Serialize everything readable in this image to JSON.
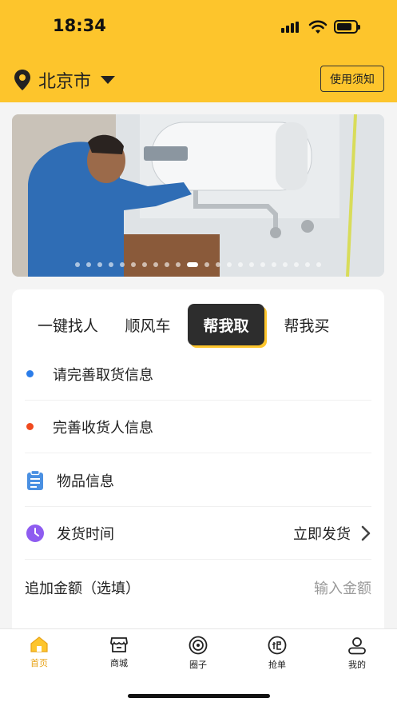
{
  "status": {
    "time": "18:34"
  },
  "header": {
    "city": "北京市",
    "notice_label": "使用须知"
  },
  "banner": {
    "slide_count": 22,
    "active_slide": 10
  },
  "service_tabs": [
    {
      "label": "一键找人",
      "active": false
    },
    {
      "label": "顺风车",
      "active": false
    },
    {
      "label": "帮我取",
      "active": true
    },
    {
      "label": "帮我买",
      "active": false
    }
  ],
  "form": {
    "pickup_info": "请完善取货信息",
    "receiver_info": "完善收货人信息",
    "item_info": "物品信息",
    "ship_time_label": "发货时间",
    "ship_time_value": "立即发货",
    "extra_amount_label": "追加金额（选填）",
    "extra_amount_placeholder": "输入金额"
  },
  "colors": {
    "brand": "#fdc52c",
    "pickup_dot": "#2b7de9",
    "receiver_dot": "#f04a1f",
    "item_icon": "#4a90e2",
    "time_icon": "#8e5cf0",
    "active_tab_text": "#e8a317"
  },
  "tabbar": [
    {
      "label": "首页",
      "icon": "home-icon",
      "active": true
    },
    {
      "label": "商城",
      "icon": "store-icon",
      "active": false
    },
    {
      "label": "圈子",
      "icon": "circle-icon",
      "active": false
    },
    {
      "label": "抢单",
      "icon": "grab-order-icon",
      "active": false
    },
    {
      "label": "我的",
      "icon": "profile-icon",
      "active": false
    }
  ]
}
